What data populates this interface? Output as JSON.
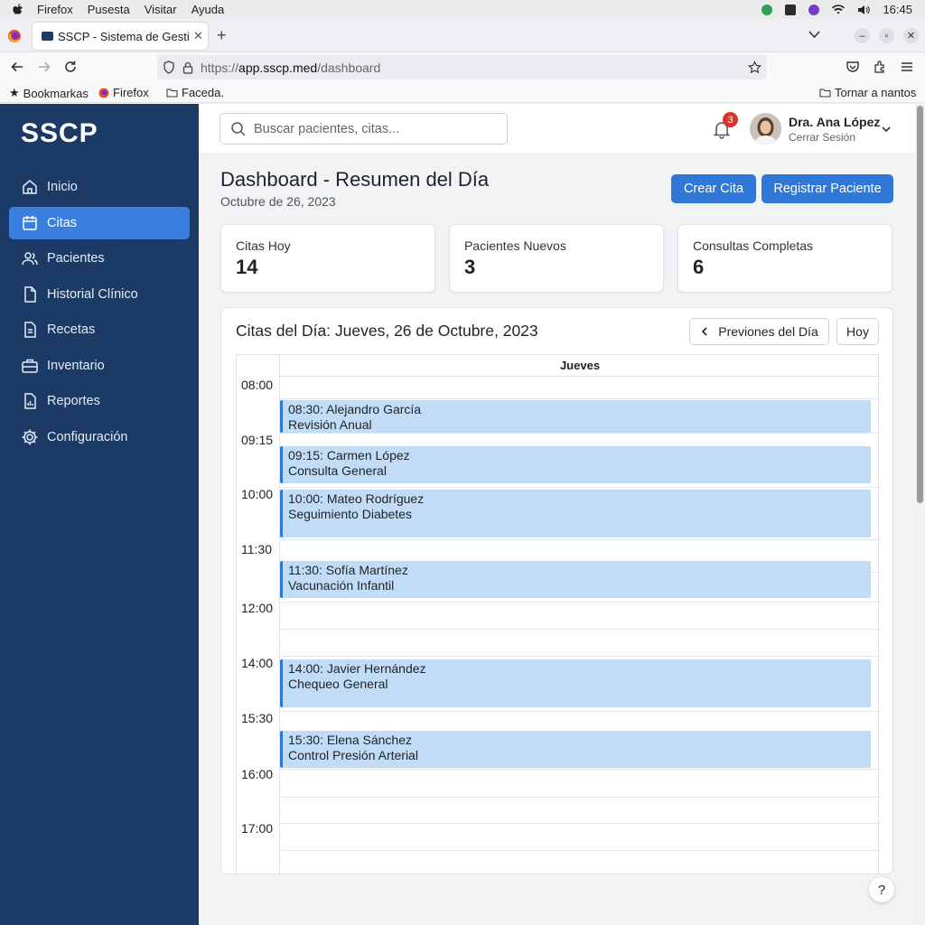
{
  "os_menu": {
    "items": [
      "Firefox",
      "Pusesta",
      "Visitar",
      "Ayuda"
    ],
    "clock": "16:45"
  },
  "browser": {
    "tab_title": "SSCP - Sistema de Gestió",
    "url_scheme": "https://",
    "url_host": "app.sscp.med",
    "url_path": "/dashboard",
    "bookmarks": [
      "Bookmarkas",
      "Firefox",
      "Faceda."
    ],
    "bookmark_right": "Tornar a nantos"
  },
  "sidebar": {
    "brand": "SSCP",
    "items": [
      {
        "label": "Inicio",
        "icon": "home-icon"
      },
      {
        "label": "Citas",
        "icon": "calendar-icon",
        "active": true
      },
      {
        "label": "Pacientes",
        "icon": "users-icon"
      },
      {
        "label": "Historial Clínico",
        "icon": "file-icon"
      },
      {
        "label": "Recetas",
        "icon": "document-icon"
      },
      {
        "label": "Inventario",
        "icon": "briefcase-icon"
      },
      {
        "label": "Reportes",
        "icon": "report-icon"
      },
      {
        "label": "Configuración",
        "icon": "gear-icon"
      }
    ]
  },
  "header": {
    "search_placeholder": "Buscar pacientes, citas...",
    "notifications": "3",
    "user_name": "Dra. Ana López",
    "logout": "Cerrar Sesión"
  },
  "page": {
    "title": "Dashboard - Resumen del Día",
    "date": "Octubre de 26, 2023",
    "btn_new_appt": "Crear Cita",
    "btn_new_patient": "Registrar Paciente"
  },
  "stats": [
    {
      "label": "Citas Hoy",
      "value": "14"
    },
    {
      "label": "Pacientes Nuevos",
      "value": "3"
    },
    {
      "label": "Consultas Completas",
      "value": "6"
    }
  ],
  "calendar": {
    "title": "Citas del Día: Jueves, 26 de Octubre, 2023",
    "prev_label": "Previones del Día",
    "today_label": "Hoy",
    "day_header": "Jueves",
    "times": [
      "08:00",
      "09:15",
      "10:00",
      "11:30",
      "12:00",
      "14:00",
      "15:30",
      "16:00",
      "17:00"
    ],
    "events": [
      {
        "line1": "08:30: Alejandro García",
        "line2": "Revisión Anual"
      },
      {
        "line1": "09:15: Carmen López",
        "line2": "Consulta General"
      },
      {
        "line1": "10:00: Mateo Rodríguez",
        "line2": "Seguimiento Diabetes"
      },
      {
        "line1": "11:30: Sofía Martínez",
        "line2": "Vacunación Infantil"
      },
      {
        "line1": "14:00: Javier Hernández",
        "line2": "Chequeo General"
      },
      {
        "line1": "15:30: Elena Sánchez",
        "line2": "Control Presión Arterial"
      }
    ]
  },
  "help": "?"
}
